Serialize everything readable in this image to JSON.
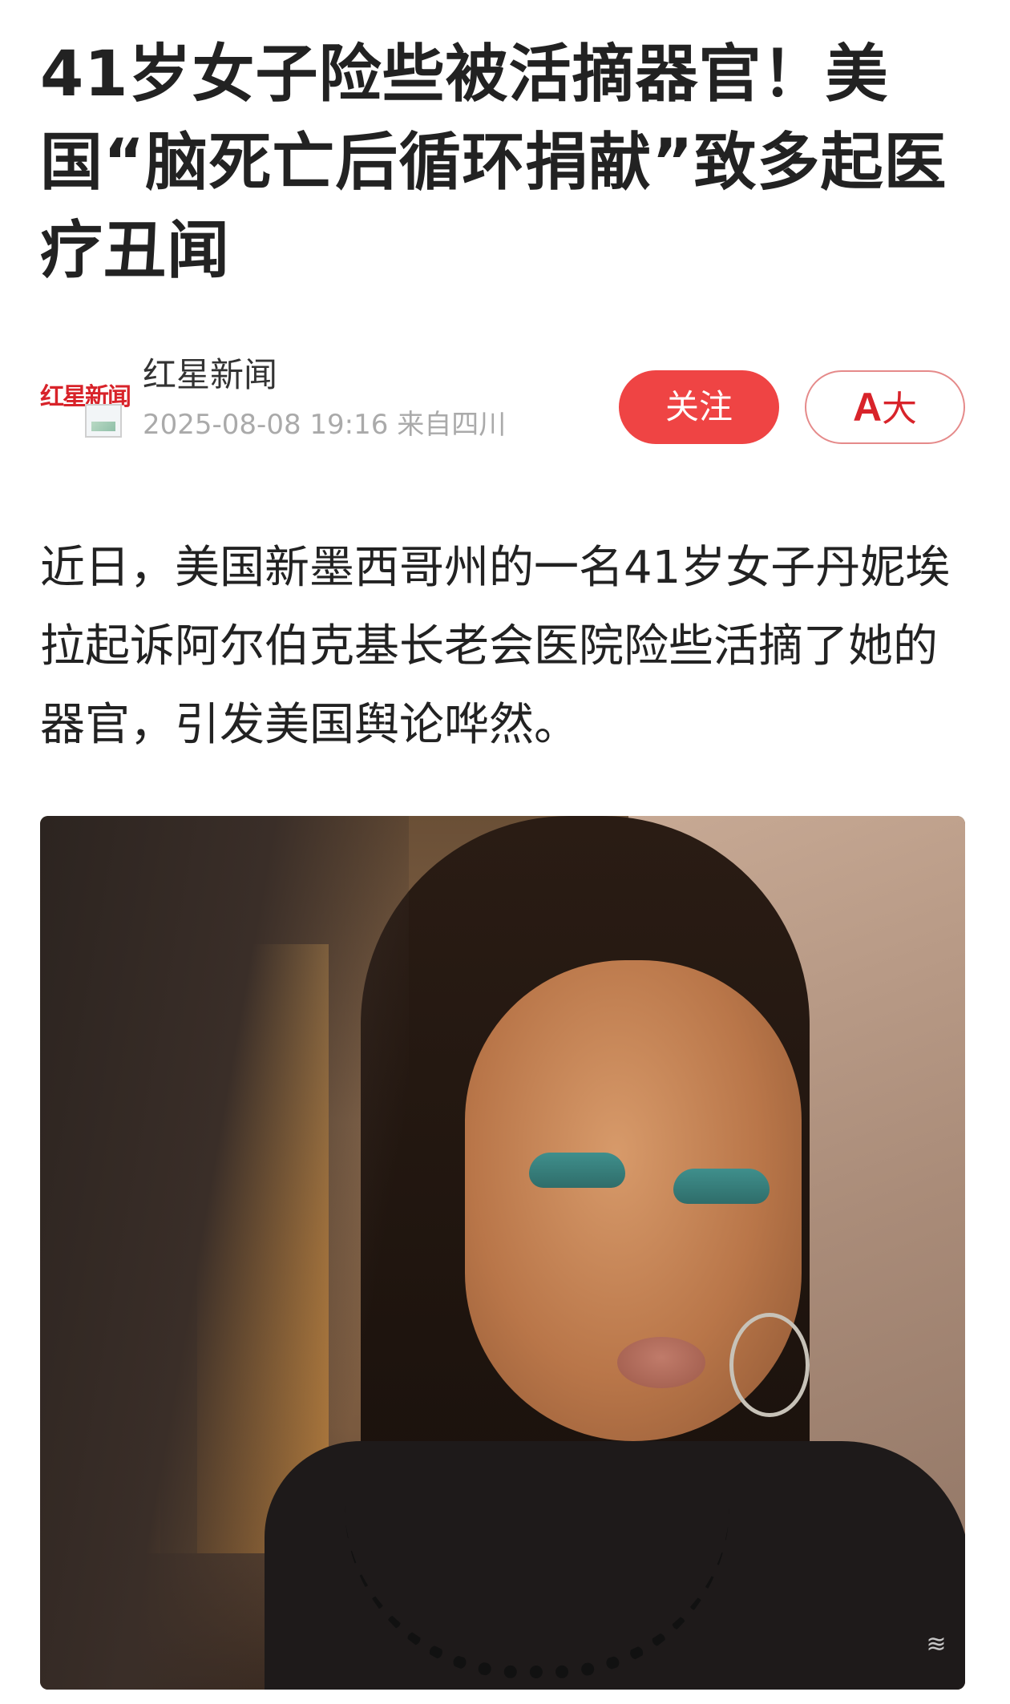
{
  "article": {
    "title": "41岁女子险些被活摘器官！美国“脑死亡后循环捐献”致多起医疗丑闻",
    "lead": "近日，美国新墨西哥州的一名41岁女子丹妮埃拉起诉阿尔伯克基长老会医院险些活摘了她的器官，引发美国舆论哗然。"
  },
  "source": {
    "logo_text": "红星新闻",
    "name": "红星新闻",
    "datetime": "2025-08-08 19:16 来自四川"
  },
  "actions": {
    "follow_label": "关注",
    "font_size_glyph": "A",
    "font_size_label": "大"
  },
  "image": {
    "subject": "selfie-photo-woman"
  },
  "colors": {
    "accent": "#ef4444",
    "title": "#222222",
    "meta": "#aaaaaa"
  }
}
